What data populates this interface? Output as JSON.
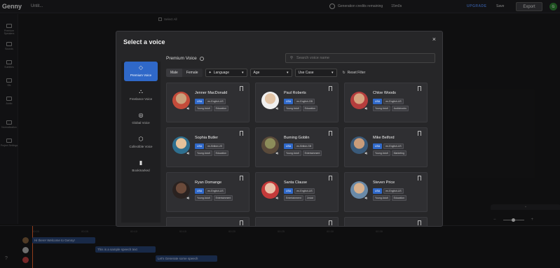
{
  "topbar": {
    "brand": "Genny",
    "doc_name": "Untit...",
    "credits_text": "Generation credits remaining",
    "credits_value": "15m0s",
    "upgrade_label": "UPGRADE",
    "save_label": "Save",
    "export_label": "Export",
    "avatar_initial": "G"
  },
  "leftrail": [
    {
      "label": "Premium Speakers",
      "icon": "speaker-icon"
    },
    {
      "label": "Sounds",
      "icon": "sound-icon"
    },
    {
      "label": "Subtitles",
      "icon": "subtitle-icon"
    },
    {
      "label": "Sfx",
      "icon": "sfx-icon"
    },
    {
      "label": "Audio",
      "icon": "audio-icon"
    },
    {
      "label": "Normalization",
      "icon": "normalize-icon"
    },
    {
      "label": "Project Settings",
      "icon": "settings-icon"
    }
  ],
  "select_all": "Select All",
  "modal": {
    "title": "Select a voice",
    "close": "×",
    "tabs": [
      {
        "label": "Premium Voice",
        "icon": "diamond-icon",
        "active": true
      },
      {
        "label": "Freelance Voice",
        "icon": "people-icon",
        "active": false
      },
      {
        "label": "Global Voice",
        "icon": "globe-icon",
        "active": false
      },
      {
        "label": "Collectible Voice",
        "icon": "collectible-icon",
        "active": false
      },
      {
        "label": "Bookmarked",
        "icon": "bookmark-icon",
        "active": false
      }
    ],
    "section_title": "Premium Voice",
    "search_placeholder": "Search voice name",
    "filters": {
      "gender_male": "Male",
      "gender_female": "Female",
      "language": "Language",
      "age": "Age",
      "use_case": "Use Case",
      "reset": "Reset Filter"
    },
    "voices": [
      {
        "name": "Jenner MacDonald",
        "lang": "en-English-US",
        "age": "Young Adult",
        "use": "Education",
        "skin": "#c9a17c",
        "bg": "#c44b3a"
      },
      {
        "name": "Paul Roberts",
        "lang": "en-English-GB",
        "age": "Young Adult",
        "use": "Education",
        "skin": "#e2c4a6",
        "bg": "#f0f0f0"
      },
      {
        "name": "Chloe Woods",
        "lang": "en-English-US",
        "age": "Young Adult",
        "use": "Audiobooks",
        "skin": "#d6a37f",
        "bg": "#b53d3d"
      },
      {
        "name": "Sophia Butler",
        "lang": "en-British-US",
        "age": "Young Adult",
        "use": "Education",
        "skin": "#e6c29a",
        "bg": "#2e6f8f"
      },
      {
        "name": "Burning Goblin",
        "lang": "en-British-GB",
        "age": "Young Adult",
        "use": "Entertainment",
        "skin": "#8c8d5a",
        "bg": "#5a4a3a"
      },
      {
        "name": "Mike Belford",
        "lang": "en-English-US",
        "age": "Young Adult",
        "use": "Marketing",
        "skin": "#c99c7a",
        "bg": "#3a5a7a"
      },
      {
        "name": "Ryan Domange",
        "lang": "en-English-US",
        "age": "Young Adult",
        "use": "Entertainment",
        "skin": "#6b4a3a",
        "bg": "#2a2220"
      },
      {
        "name": "Santa Clause",
        "lang": "en-English-US",
        "age": "Entertainment",
        "use": "Jovial",
        "skin": "#e8c0a8",
        "bg": "#c43a3a"
      },
      {
        "name": "Steven Price",
        "lang": "en-English-US",
        "age": "Young Adult",
        "use": "Education",
        "skin": "#d8b08c",
        "bg": "#6a8aa8"
      }
    ]
  },
  "timeline": {
    "ticks": [
      "00:00",
      "00:05",
      "00:10",
      "00:15",
      "00:20",
      "00:25",
      "00:30",
      "00:35"
    ],
    "clips": [
      {
        "text": "Hi there! Welcome to Genny!"
      },
      {
        "text": "This is a sample speech text"
      },
      {
        "text": "Let's Generate some speech"
      }
    ]
  },
  "colors": {
    "accent": "#2f68c8",
    "background": "#18181a",
    "modal": "#262628"
  }
}
